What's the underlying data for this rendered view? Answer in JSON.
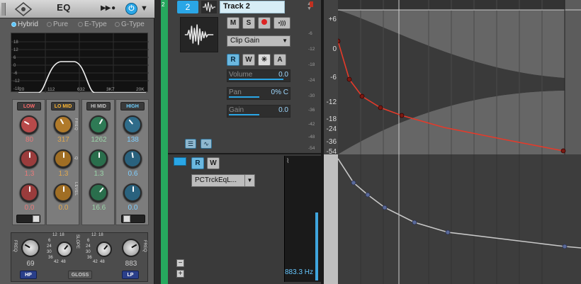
{
  "eq": {
    "title": "EQ",
    "arrows": "▶▶ ●",
    "power_glyph": "⏻",
    "menu_glyph": "▼",
    "modes": [
      {
        "label": "Hybrid",
        "selected": true
      },
      {
        "label": "Pure",
        "selected": false
      },
      {
        "label": "E-Type",
        "selected": false
      },
      {
        "label": "G-Type",
        "selected": false
      }
    ],
    "y_labels": [
      "18",
      "12",
      "6",
      "0",
      "-6",
      "-12",
      "-18"
    ],
    "x_labels": [
      "20",
      "112",
      "632",
      "3K7",
      "20K"
    ],
    "bands": [
      {
        "label": "LOW",
        "color": "#e34a4a",
        "freq": "80",
        "gain": "1.3",
        "q": "0.0"
      },
      {
        "label": "LO MID",
        "color": "#f0a020",
        "freq": "317",
        "gain": "1.3",
        "q": "0.0"
      },
      {
        "label": "HI MID",
        "color": "#9ad4a8",
        "freq": "1262",
        "gain": "1.3",
        "q": "16.6"
      },
      {
        "label": "HIGH",
        "color": "#5cc6ff",
        "freq": "138",
        "gain": "0.6",
        "q": "0.0"
      }
    ],
    "side_labels": {
      "freq": "FREQ",
      "q": "Q",
      "level": "LEVEL"
    },
    "filter": {
      "hp_label": "HP",
      "lp_label": "LP",
      "gloss_label": "GLOSS",
      "hp_value": "69",
      "lp_value": "883",
      "freq_side": "FREQ",
      "slope_side": "SLOPE",
      "hp_scale": [
        "12",
        "18",
        "6",
        "24",
        "30",
        "36",
        "42",
        "48"
      ],
      "lp_scale": [
        "12",
        "18",
        "6",
        "24",
        "30",
        "36",
        "42",
        "48"
      ]
    }
  },
  "track": {
    "strip_number": "2",
    "number": "2",
    "name": "Track 2",
    "buttons": {
      "mute": "M",
      "solo": "S",
      "read": "R",
      "write": "W",
      "asterisk": "✳",
      "arm": "A",
      "echo": "•)))"
    },
    "clip_gain": "Clip Gain",
    "params": [
      {
        "label": "Volume",
        "value": "0.0",
        "fill": 0.9
      },
      {
        "label": "Pan",
        "value": "0% C",
        "fill": 0.5
      },
      {
        "label": "Gain",
        "value": "0.0",
        "fill": 0.5
      }
    ],
    "meter_labels": [
      "-6",
      "-12",
      "-18",
      "-24",
      "-30",
      "-36",
      "-42",
      "-48",
      "-54"
    ],
    "lane": {
      "read": "R",
      "write": "W",
      "envelope": "PCTrckEqL...",
      "readout": "883.3 Hz",
      "zoom_out": "−",
      "zoom_in": "+"
    }
  },
  "clip": {
    "db_labels": [
      "+6",
      "0",
      "-6",
      "-12",
      "-18",
      "-24",
      "-36",
      "-54"
    ]
  },
  "colors": {
    "accent": "#2aa6e6",
    "track_green": "#26a85e",
    "envelope_red": "#e53a2a",
    "envelope_gray": "#c8c8c8"
  }
}
